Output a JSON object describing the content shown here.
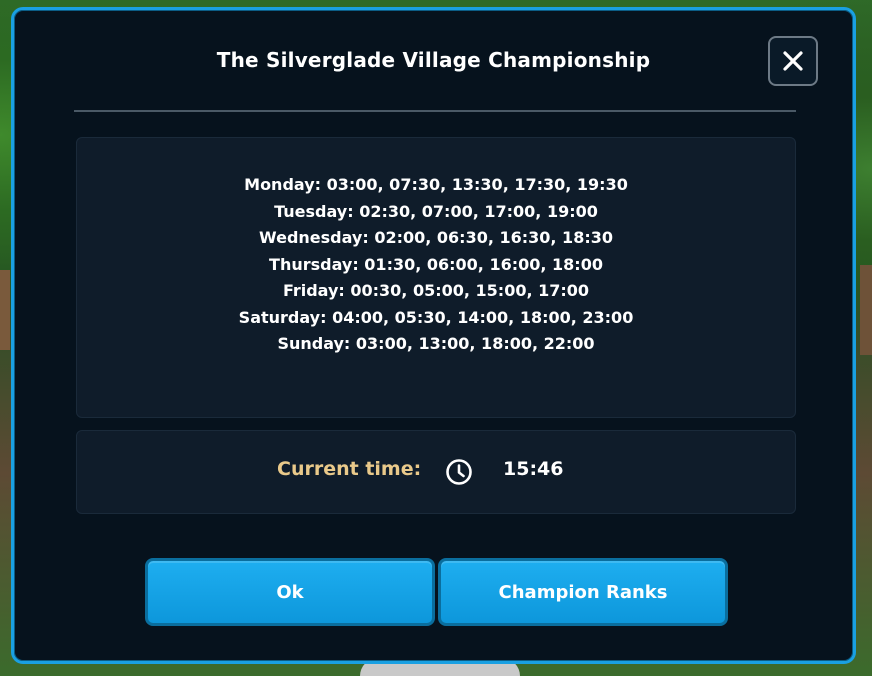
{
  "dialog": {
    "title": "The Silverglade Village Championship",
    "close_icon": "close-icon"
  },
  "schedule": [
    {
      "day": "Monday",
      "times": "03:00, 07:30, 13:30, 17:30, 19:30",
      "line": "Monday: 03:00, 07:30, 13:30, 17:30, 19:30"
    },
    {
      "day": "Tuesday",
      "times": "02:30, 07:00, 17:00, 19:00",
      "line": "Tuesday: 02:30, 07:00, 17:00, 19:00"
    },
    {
      "day": "Wednesday",
      "times": "02:00, 06:30, 16:30, 18:30",
      "line": "Wednesday: 02:00, 06:30, 16:30, 18:30"
    },
    {
      "day": "Thursday",
      "times": "01:30, 06:00, 16:00, 18:00",
      "line": "Thursday: 01:30, 06:00, 16:00, 18:00"
    },
    {
      "day": "Friday",
      "times": "00:30, 05:00, 15:00, 17:00",
      "line": "Friday: 00:30, 05:00, 15:00, 17:00"
    },
    {
      "day": "Saturday",
      "times": "04:00, 05:30, 14:00, 18:00, 23:00",
      "line": "Saturday: 04:00, 05:30, 14:00, 18:00, 23:00"
    },
    {
      "day": "Sunday",
      "times": "03:00, 13:00, 18:00, 22:00",
      "line": "Sunday: 03:00, 13:00, 18:00, 22:00"
    }
  ],
  "current_time": {
    "label": "Current time:",
    "icon": "clock-icon",
    "value": "15:46"
  },
  "buttons": {
    "ok_label": "Ok",
    "ranks_label": "Champion Ranks"
  },
  "colors": {
    "accent": "#1aa0e2",
    "panel_bg": "#0f1c2a",
    "dialog_bg": "#06121d",
    "label_gold": "#e9c98a"
  }
}
